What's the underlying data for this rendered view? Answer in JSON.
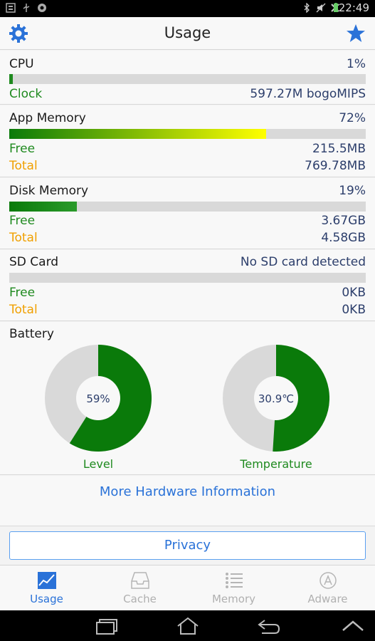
{
  "statusbar": {
    "time": "22:49"
  },
  "header": {
    "title": "Usage"
  },
  "cpu": {
    "label": "CPU",
    "percent": "1%",
    "fill": 0.01,
    "clock_label": "Clock",
    "clock_value": "597.27M bogoMIPS"
  },
  "app_memory": {
    "label": "App Memory",
    "percent": "72%",
    "fill": 0.72,
    "free_label": "Free",
    "free_value": "215.5MB",
    "total_label": "Total",
    "total_value": "769.78MB"
  },
  "disk_memory": {
    "label": "Disk Memory",
    "percent": "19%",
    "fill": 0.19,
    "free_label": "Free",
    "free_value": "3.67GB",
    "total_label": "Total",
    "total_value": "4.58GB"
  },
  "sd_card": {
    "label": "SD Card",
    "status": "No SD card detected",
    "fill": 0,
    "free_label": "Free",
    "free_value": "0KB",
    "total_label": "Total",
    "total_value": "0KB"
  },
  "battery": {
    "label": "Battery",
    "level": {
      "value": "59%",
      "fraction": 0.59,
      "label": "Level"
    },
    "temperature": {
      "value": "30.9℃",
      "fraction": 0.51,
      "label": "Temperature"
    }
  },
  "links": {
    "more_hardware": "More Hardware Information"
  },
  "privacy": {
    "label": "Privacy"
  },
  "tabs": [
    {
      "label": "Usage",
      "icon": "chart-icon",
      "active": true
    },
    {
      "label": "Cache",
      "icon": "tray-icon",
      "active": false
    },
    {
      "label": "Memory",
      "icon": "list-icon",
      "active": false
    },
    {
      "label": "Adware",
      "icon": "app-store-icon",
      "active": false
    }
  ],
  "colors": {
    "accent": "#2a72d8",
    "green": "#1f8a1f",
    "orange": "#f0a000",
    "bar_bg": "#d9d9d9"
  }
}
